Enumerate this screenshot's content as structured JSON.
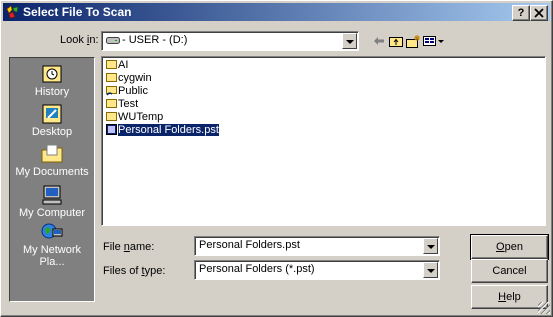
{
  "window": {
    "title": "Select File To Scan",
    "help_button": "?",
    "close_button": "x"
  },
  "lookin": {
    "label_pre": "Look ",
    "label_ul": "i",
    "label_post": "n:",
    "value": "- USER - (D:)"
  },
  "toolbar": {
    "back_icon": "back-arrow-icon",
    "up_icon": "up-folder-icon",
    "new_folder_icon": "new-folder-icon",
    "view_menu_icon": "view-menu-icon"
  },
  "places": [
    {
      "label": "History",
      "icon": "history-icon"
    },
    {
      "label": "Desktop",
      "icon": "desktop-icon"
    },
    {
      "label": "My Documents",
      "icon": "my-documents-icon"
    },
    {
      "label": "My Computer",
      "icon": "my-computer-icon"
    },
    {
      "label": "My Network Pla...",
      "icon": "my-network-places-icon"
    }
  ],
  "files": [
    {
      "name": "AI",
      "type": "folder"
    },
    {
      "name": "cygwin",
      "type": "folder"
    },
    {
      "name": "Public",
      "type": "shared-folder"
    },
    {
      "name": "Test",
      "type": "folder"
    },
    {
      "name": "WUTemp",
      "type": "folder"
    },
    {
      "name": "Personal Folders.pst",
      "type": "pst-file",
      "selected": true
    }
  ],
  "filename": {
    "label_pre": "File ",
    "label_ul": "n",
    "label_post": "ame:",
    "value": "Personal Folders.pst"
  },
  "filetype": {
    "label_pre": "Files of ",
    "label_ul": "t",
    "label_post": "ype:",
    "value": "Personal Folders (*.pst)"
  },
  "buttons": {
    "open_ul": "O",
    "open_rest": "pen",
    "cancel": "Cancel",
    "help_ul": "H",
    "help_rest": "elp"
  },
  "colors": {
    "titlebar_start": "#0a246a",
    "titlebar_end": "#a6caf0",
    "dialog_face": "#d4d0c8",
    "places_bar": "#808080",
    "selection": "#0a246a"
  }
}
